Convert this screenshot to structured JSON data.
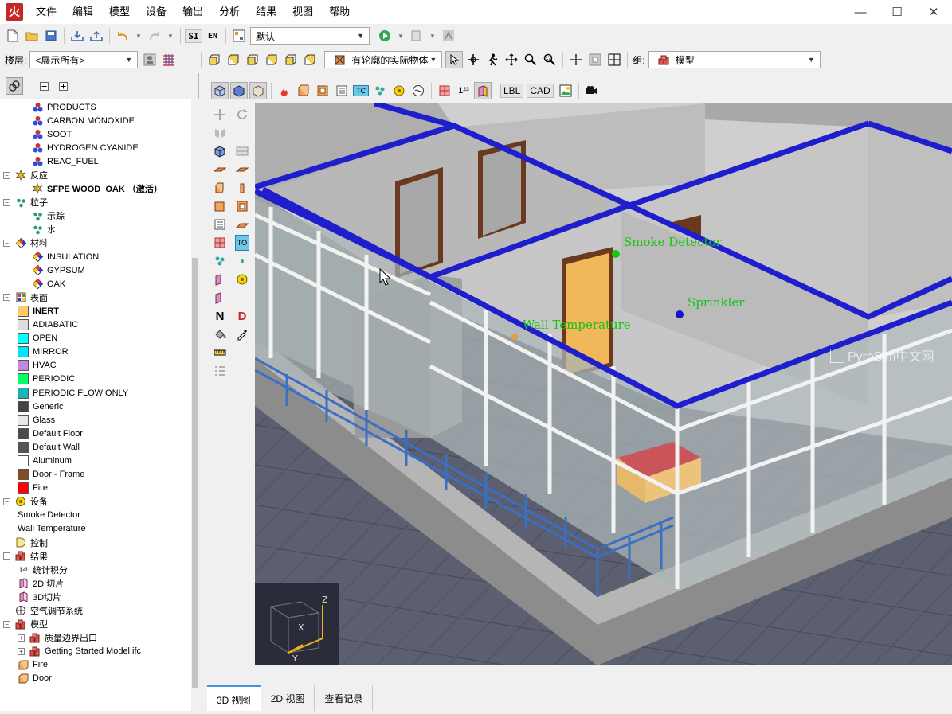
{
  "window": {
    "app_icon": "火",
    "minimize": "—",
    "maximize": "☐",
    "close": "✕"
  },
  "menu": [
    "文件",
    "编辑",
    "模型",
    "设备",
    "输出",
    "分析",
    "结果",
    "视图",
    "帮助"
  ],
  "toolbar1": {
    "si": "SI",
    "en": "EN",
    "view_value": "默认"
  },
  "toolbar2": {
    "floor_label": "楼层:",
    "floor_value": "<展示所有>",
    "render_mode": "有轮廓的实际物体",
    "group_label": "组:",
    "group_value": "模型"
  },
  "toolbar3": {
    "superscript": "1²³",
    "lbl": "LBL",
    "cad": "CAD"
  },
  "side_toolbar": {
    "n": "N",
    "d": "D"
  },
  "tree": [
    {
      "indent": 2,
      "type": "species",
      "label": "PRODUCTS"
    },
    {
      "indent": 2,
      "type": "species",
      "label": "CARBON MONOXIDE"
    },
    {
      "indent": 2,
      "type": "species",
      "label": "SOOT"
    },
    {
      "indent": 2,
      "type": "species",
      "label": "HYDROGEN CYANIDE"
    },
    {
      "indent": 2,
      "type": "species",
      "label": "REAC_FUEL"
    },
    {
      "indent": 0,
      "exp": "−",
      "type": "reaction",
      "label": "反应"
    },
    {
      "indent": 2,
      "type": "reaction",
      "label": "SFPE WOOD_OAK （激活）",
      "bold": true
    },
    {
      "indent": 0,
      "exp": "−",
      "type": "particle",
      "label": "粒子"
    },
    {
      "indent": 2,
      "type": "particle",
      "label": "示踪"
    },
    {
      "indent": 2,
      "type": "particle",
      "label": "水"
    },
    {
      "indent": 0,
      "exp": "−",
      "type": "material",
      "label": "材料"
    },
    {
      "indent": 2,
      "type": "material",
      "label": "INSULATION"
    },
    {
      "indent": 2,
      "type": "material",
      "label": "GYPSUM"
    },
    {
      "indent": 2,
      "type": "material",
      "label": "OAK"
    },
    {
      "indent": 0,
      "exp": "−",
      "type": "surface",
      "label": "表面"
    },
    {
      "indent": 1,
      "type": "swatch",
      "color": "#ffcc66",
      "label": "INERT",
      "bold": true
    },
    {
      "indent": 1,
      "type": "swatch",
      "color": "#dddddd",
      "label": "ADIABATIC"
    },
    {
      "indent": 1,
      "type": "swatch",
      "color": "#00ffff",
      "label": "OPEN"
    },
    {
      "indent": 1,
      "type": "swatch",
      "color": "#00e5ff",
      "label": "MIRROR"
    },
    {
      "indent": 1,
      "type": "swatch",
      "color": "#c08ae0",
      "label": "HVAC"
    },
    {
      "indent": 1,
      "type": "swatch",
      "color": "#00ff66",
      "label": "PERIODIC"
    },
    {
      "indent": 1,
      "type": "swatch",
      "color": "#19b5b5",
      "label": "PERIODIC FLOW ONLY"
    },
    {
      "indent": 1,
      "type": "swatch",
      "color": "#444444",
      "label": "Generic"
    },
    {
      "indent": 1,
      "type": "swatch",
      "color": "#e8e8e8",
      "label": "Glass"
    },
    {
      "indent": 1,
      "type": "swatch",
      "color": "#4a4a4a",
      "label": "Default Floor"
    },
    {
      "indent": 1,
      "type": "swatch",
      "color": "#555555",
      "label": "Default Wall"
    },
    {
      "indent": 1,
      "type": "swatch",
      "color": "#ffffff",
      "label": "Aluminum"
    },
    {
      "indent": 1,
      "type": "swatch",
      "color": "#8b4a26",
      "label": "Door - Frame"
    },
    {
      "indent": 1,
      "type": "swatch",
      "color": "#ff0000",
      "label": "Fire"
    },
    {
      "indent": 0,
      "exp": "−",
      "type": "device",
      "label": "设备"
    },
    {
      "indent": 1,
      "type": "none",
      "label": "Smoke Detector"
    },
    {
      "indent": 1,
      "type": "none",
      "label": "Wall Temperature"
    },
    {
      "indent": 0,
      "type": "control",
      "label": "控制"
    },
    {
      "indent": 0,
      "exp": "−",
      "type": "result",
      "label": "结果"
    },
    {
      "indent": 1,
      "type": "stat",
      "label": "统计积分"
    },
    {
      "indent": 1,
      "type": "slice",
      "label": "2D 切片"
    },
    {
      "indent": 1,
      "type": "slice",
      "label": "3D切片"
    },
    {
      "indent": 0,
      "type": "hvac",
      "label": "空气调节系统"
    },
    {
      "indent": 0,
      "exp": "−",
      "type": "model",
      "label": "模型"
    },
    {
      "indent": 1,
      "exp": "+",
      "type": "model",
      "label": "质量边界出口"
    },
    {
      "indent": 1,
      "exp": "+",
      "type": "model",
      "label": "Getting Started Model.ifc"
    },
    {
      "indent": 1,
      "type": "obst",
      "label": "Fire"
    },
    {
      "indent": 1,
      "type": "obst",
      "label": "Door"
    }
  ],
  "viewport": {
    "labels": {
      "smoke_detector": "Smoke Detector",
      "sprinkler": "Sprinkler",
      "wall_temperature": "Wall Temperature"
    },
    "axes": {
      "x": "X",
      "y": "Y",
      "z": "Z"
    },
    "watermark": "PyroSim中文网"
  },
  "bottom_tabs": [
    "3D 视图",
    "2D 视图",
    "查看记录"
  ]
}
